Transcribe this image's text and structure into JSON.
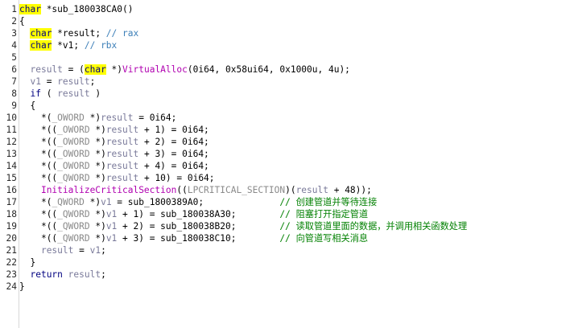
{
  "line_numbers": [
    "1",
    "2",
    "3",
    "4",
    "5",
    "6",
    "7",
    "8",
    "9",
    "10",
    "11",
    "12",
    "13",
    "14",
    "15",
    "16",
    "17",
    "18",
    "19",
    "20",
    "21",
    "22",
    "23",
    "24"
  ],
  "code": {
    "l1": {
      "kw": "char",
      "rest": " *sub_180038CA0()"
    },
    "l2": {
      "text": "{"
    },
    "l3": {
      "kw": "char",
      "rest": " *result; ",
      "cmt": "// rax"
    },
    "l4": {
      "kw": "char",
      "rest": " *v1; ",
      "cmt": "// rbx"
    },
    "l5": {
      "text": ""
    },
    "l6": {
      "a": "result",
      "b": " = (",
      "kw": "char",
      "c": " *)",
      "fn": "VirtualAlloc",
      "d": "(0i64, 0x58ui64, 0x1000u, 4u);"
    },
    "l7": {
      "a": "v1",
      "b": " = ",
      "c": "result",
      "d": ";"
    },
    "l8": {
      "a": "if",
      "b": " ( ",
      "c": "result",
      "d": " )"
    },
    "l9": {
      "text": "{"
    },
    "l10": {
      "a": "*(",
      "t": "_OWORD",
      "b": " *)",
      "v": "result",
      "c": " = 0i64;"
    },
    "l11": {
      "a": "*((",
      "t": "_OWORD",
      "b": " *)",
      "v": "result",
      "c": " + 1) = 0i64;"
    },
    "l12": {
      "a": "*((",
      "t": "_OWORD",
      "b": " *)",
      "v": "result",
      "c": " + 2) = 0i64;"
    },
    "l13": {
      "a": "*((",
      "t": "_OWORD",
      "b": " *)",
      "v": "result",
      "c": " + 3) = 0i64;"
    },
    "l14": {
      "a": "*((",
      "t": "_OWORD",
      "b": " *)",
      "v": "result",
      "c": " + 4) = 0i64;"
    },
    "l15": {
      "a": "*((",
      "t": "_QWORD",
      "b": " *)",
      "v": "result",
      "c": " + 10) = 0i64;"
    },
    "l16": {
      "fn": "InitializeCriticalSection",
      "a": "((",
      "t": "LPCRITICAL_SECTION",
      "b": ")(",
      "v": "result",
      "c": " + 48));"
    },
    "l17": {
      "a": "*(",
      "t": "_QWORD",
      "b": " *)",
      "v": "v1",
      "c": " = sub_1800389A0;",
      "pad": "              ",
      "cmt": "// 创建管道并等待连接"
    },
    "l18": {
      "a": "*((",
      "t": "_QWORD",
      "b": " *)",
      "v": "v1",
      "c": " + 1) = sub_180038A30;",
      "pad": "        ",
      "cmt": "// 阻塞打开指定管道"
    },
    "l19": {
      "a": "*((",
      "t": "_QWORD",
      "b": " *)",
      "v": "v1",
      "c": " + 2) = sub_180038B20;",
      "pad": "        ",
      "cmt": "// 读取管道里面的数据，并调用相关函数处理"
    },
    "l20": {
      "a": "*((",
      "t": "_QWORD",
      "b": " *)",
      "v": "v1",
      "c": " + 3) = sub_180038C10;",
      "pad": "        ",
      "cmt": "// 向管道写相关消息"
    },
    "l21": {
      "a": "result",
      "b": " = ",
      "c": "v1",
      "d": ";"
    },
    "l22": {
      "text": "}"
    },
    "l23": {
      "a": "return",
      "b": " ",
      "c": "result",
      "d": ";"
    },
    "l24": {
      "text": "}"
    }
  }
}
